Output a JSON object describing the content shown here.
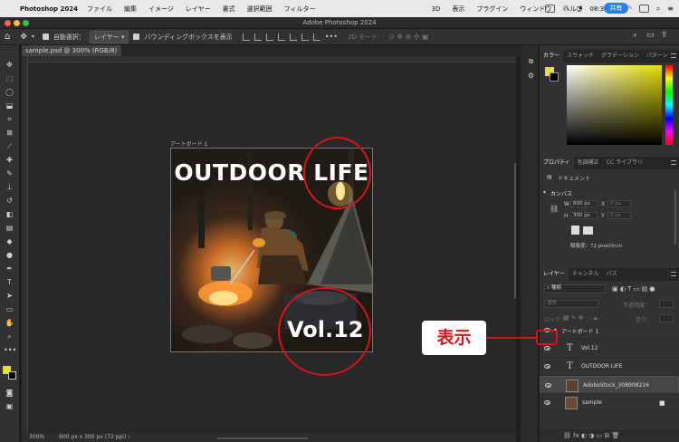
{
  "menubar": {
    "app_name": "Photoshop 2024",
    "items": [
      "ファイル",
      "編集",
      "イメージ",
      "レイヤー",
      "書式",
      "選択範囲",
      "フィルター",
      "3D",
      "表示",
      "プラグイン",
      "ウィンドウ",
      "ヘルプ"
    ],
    "clock": "08:38:26"
  },
  "window": {
    "title": "Adobe Photoshop 2024"
  },
  "optbar": {
    "auto_select_label": "自動選択：",
    "auto_select_value": "レイヤー",
    "bounding_box_label": "バウンディングボックスを表示",
    "mode_3d": "3D モード：",
    "share_label": "共有"
  },
  "document": {
    "tab_label": "sample.psd @ 300% (RGB/8)",
    "artboard_label": "アートボード 1",
    "headline": "OUTDOOR LIFE",
    "vol_text": "Vol.12",
    "zoom": "300%",
    "size_info": "600 px x 300 px (72 ppi)"
  },
  "annotation": {
    "label": "表示",
    "color": "#d8141c"
  },
  "color_panel": {
    "tabs": [
      "カラー",
      "スウォッチ",
      "グラデーション",
      "パターン"
    ],
    "foreground": "#f2e600",
    "background": "#000000"
  },
  "properties_panel": {
    "tabs": [
      "プロパティ",
      "色調補正",
      "CC ライブラリ"
    ],
    "doc_label": "ドキュメント",
    "section_canvas": "カンバス",
    "w_label": "W",
    "w_value": "600 px",
    "h_label": "H",
    "h_value": "300 px",
    "x_label": "X",
    "x_value": "0 px",
    "y_label": "Y",
    "y_value": "0 px",
    "resolution": "解像度：72 pixel/inch"
  },
  "layers_panel": {
    "tabs": [
      "レイヤー",
      "チャンネル",
      "パス"
    ],
    "filter_label": "種類",
    "blend_mode": "通常",
    "opacity_label": "不透明度：",
    "lock_label": "ロック：",
    "fill_label": "塗り：",
    "layers": [
      {
        "name": "アートボード 1",
        "kind": "artboard"
      },
      {
        "name": "Vol.12",
        "kind": "text"
      },
      {
        "name": "OUTDOOR LIFE",
        "kind": "text"
      },
      {
        "name": "AdobeStock_308908216",
        "kind": "image"
      },
      {
        "name": "sample",
        "kind": "image"
      }
    ]
  }
}
